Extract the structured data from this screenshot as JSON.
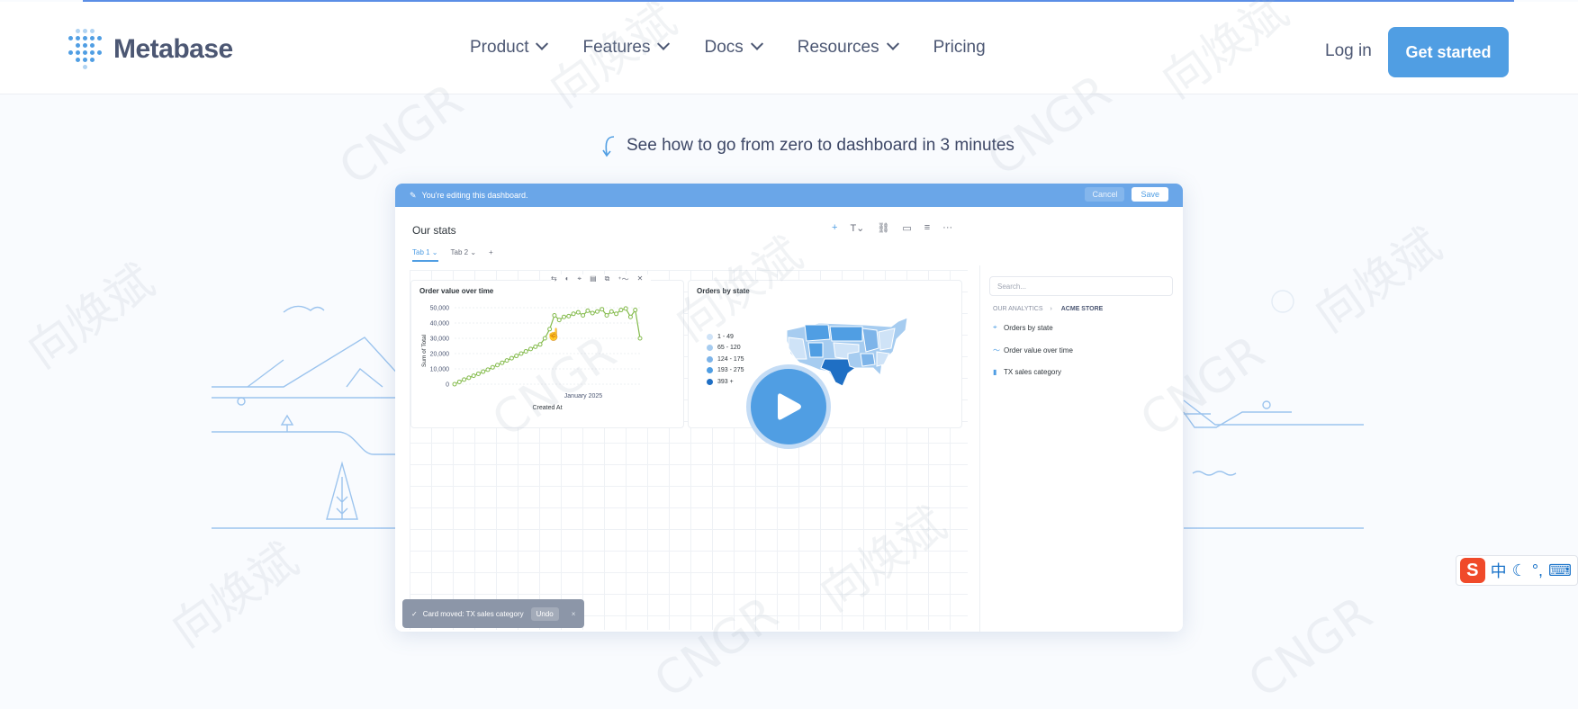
{
  "header": {
    "logo_text": "Metabase",
    "nav": [
      {
        "label": "Product",
        "has_menu": true
      },
      {
        "label": "Features",
        "has_menu": true
      },
      {
        "label": "Docs",
        "has_menu": true
      },
      {
        "label": "Resources",
        "has_menu": true
      },
      {
        "label": "Pricing",
        "has_menu": false
      }
    ],
    "login_label": "Log in",
    "cta_label": "Get started"
  },
  "hero": {
    "hint": "See how to go from zero to dashboard in 3 minutes"
  },
  "dashboard": {
    "editing_banner": "You're editing this dashboard.",
    "cancel_label": "Cancel",
    "save_label": "Save",
    "title": "Our stats",
    "tabs": [
      "Tab 1",
      "Tab 2"
    ],
    "add_tab": "+",
    "toolbar_icons": [
      "plus-icon",
      "text-icon",
      "link-icon",
      "section-icon",
      "filter-icon",
      "more-icon"
    ],
    "card_line": {
      "title": "Order value over time",
      "ylabel": "Sum of Total",
      "xlabel": "Created At",
      "x_tick": "January 2025",
      "y_ticks": [
        "50,000",
        "40,000",
        "30,000",
        "20,000",
        "10,000",
        "0"
      ]
    },
    "card_map": {
      "title": "Orders by state",
      "legend": [
        {
          "label": "1 - 49",
          "color": "#cfe3f7"
        },
        {
          "label": "65 - 120",
          "color": "#a6ccf0"
        },
        {
          "label": "124 - 175",
          "color": "#7db4e9"
        },
        {
          "label": "193 - 275",
          "color": "#509ee3"
        },
        {
          "label": "393 +",
          "color": "#1f6fc4"
        }
      ]
    },
    "sidebar": {
      "search_placeholder": "Search...",
      "crumb_parent": "OUR ANALYTICS",
      "crumb_current": "ACME STORE",
      "items": [
        {
          "label": "Orders by state",
          "icon": "pin-icon"
        },
        {
          "label": "Order value over time",
          "icon": "line-icon"
        },
        {
          "label": "TX sales category",
          "icon": "bar-icon"
        }
      ]
    },
    "toast": {
      "text": "Card moved: TX sales category",
      "undo": "Undo",
      "close": "×"
    }
  },
  "ime": {
    "logo": "S",
    "lang": "中",
    "moon": "☾",
    "punct": "°,",
    "keyboard": "⌨"
  },
  "colors": {
    "brand": "#509ee3",
    "text": "#4c5773",
    "line_series": "#84bb4c"
  },
  "chart_data": {
    "type": "line",
    "title": "Order value over time",
    "xlabel": "Created At",
    "ylabel": "Sum of Total",
    "ylim": [
      0,
      50000
    ],
    "x_tick_labels": [
      "January 2025"
    ],
    "series": [
      {
        "values": [
          0,
          1500,
          3000,
          4200,
          5500,
          6800,
          8200,
          9500,
          11000,
          12500,
          14000,
          15500,
          17000,
          18500,
          20000,
          21500,
          23000,
          24500,
          26000,
          30000,
          36000,
          45000,
          42000,
          44000,
          44500,
          46000,
          47000,
          45000,
          48000,
          46500,
          47500,
          49000,
          45000,
          47500,
          46000,
          48500,
          49500,
          44000,
          48500,
          30000
        ]
      }
    ]
  }
}
